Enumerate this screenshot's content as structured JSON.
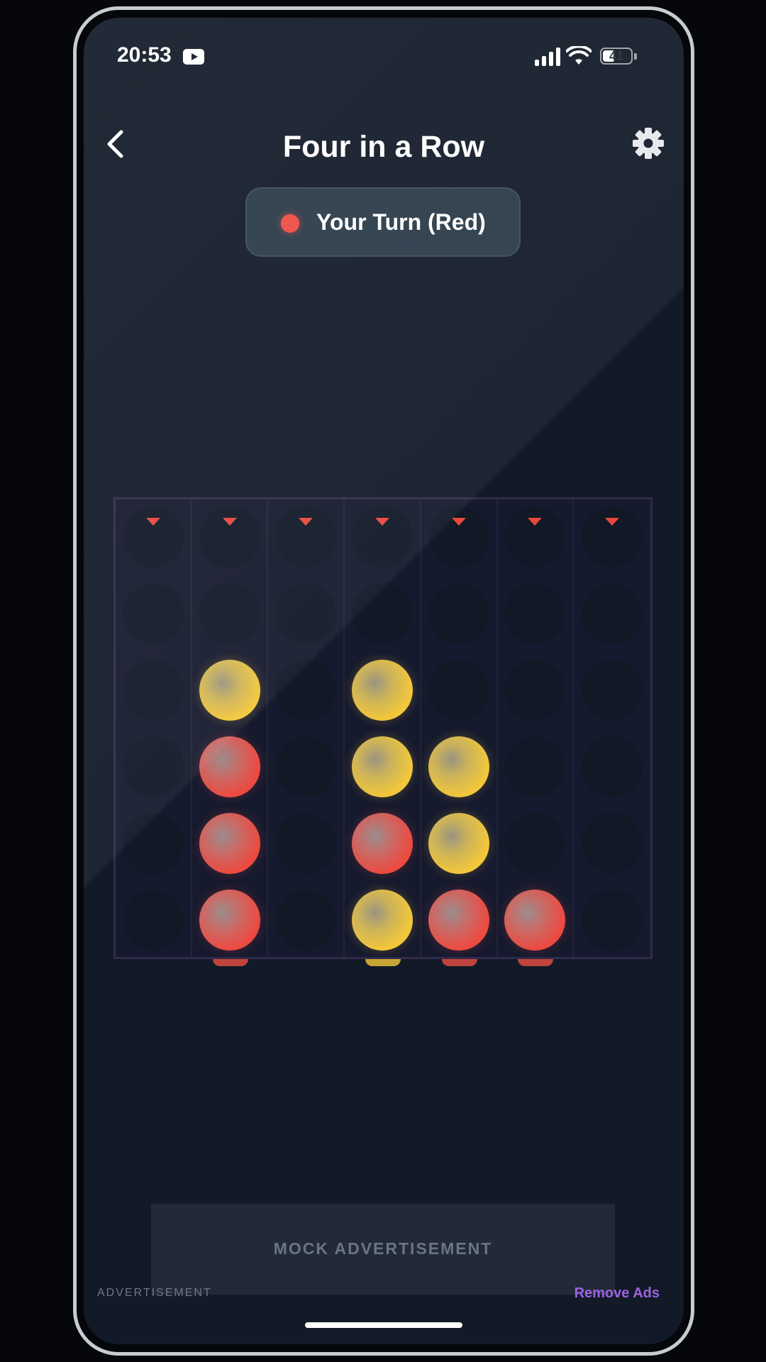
{
  "status_bar": {
    "time": "20:53",
    "battery": "41",
    "icons": [
      "youtube-icon",
      "signal-icon",
      "wifi-icon",
      "battery-icon"
    ]
  },
  "header": {
    "title": "Four in a Row",
    "back_icon": "chevron-left-icon",
    "settings_icon": "gear-icon"
  },
  "turn": {
    "label": "Your Turn (Red)",
    "player_color": "#ee4d44"
  },
  "board": {
    "columns": 7,
    "rows": 6,
    "drop_arrow_color": "#e8483e",
    "pieces_by_column": [
      [],
      [
        "red",
        "red",
        "red",
        "yellow"
      ],
      [],
      [
        "yellow",
        "red",
        "yellow",
        "yellow"
      ],
      [
        "red",
        "yellow",
        "yellow"
      ],
      [
        "red"
      ],
      []
    ],
    "colors": {
      "red": "#ee4d44",
      "yellow": "#f5c838"
    }
  },
  "ad": {
    "banner_text": "MOCK ADVERTISEMENT",
    "label": "ADVERTISEMENT",
    "remove_ads_label": "Remove Ads"
  }
}
